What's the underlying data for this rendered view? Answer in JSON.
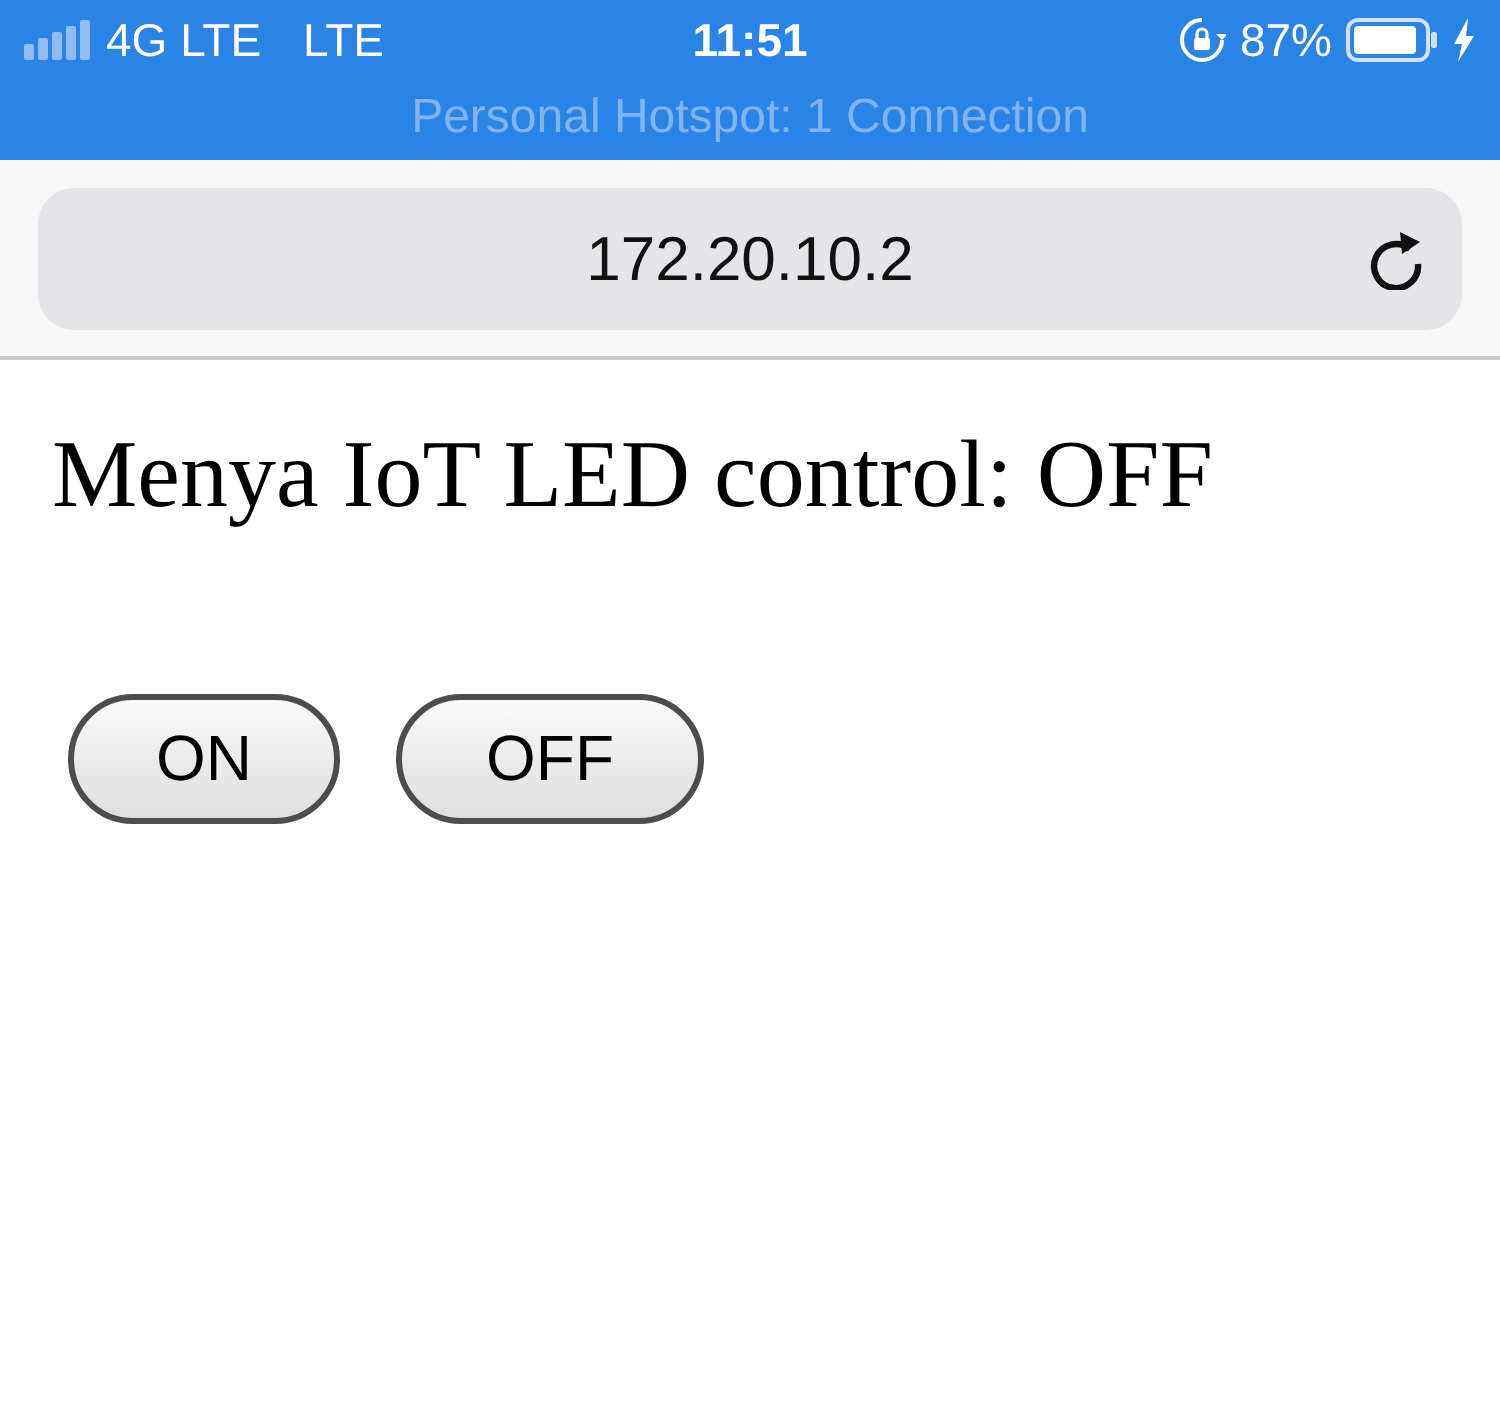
{
  "status_bar": {
    "carrier": "4G LTE",
    "network": "LTE",
    "time": "11:51",
    "battery": "87%",
    "banner": "Personal Hotspot: 1 Connection"
  },
  "address_bar": {
    "url": "172.20.10.2"
  },
  "page": {
    "heading": "Menya IoT LED control: OFF",
    "buttons": [
      "ON",
      "OFF"
    ]
  }
}
